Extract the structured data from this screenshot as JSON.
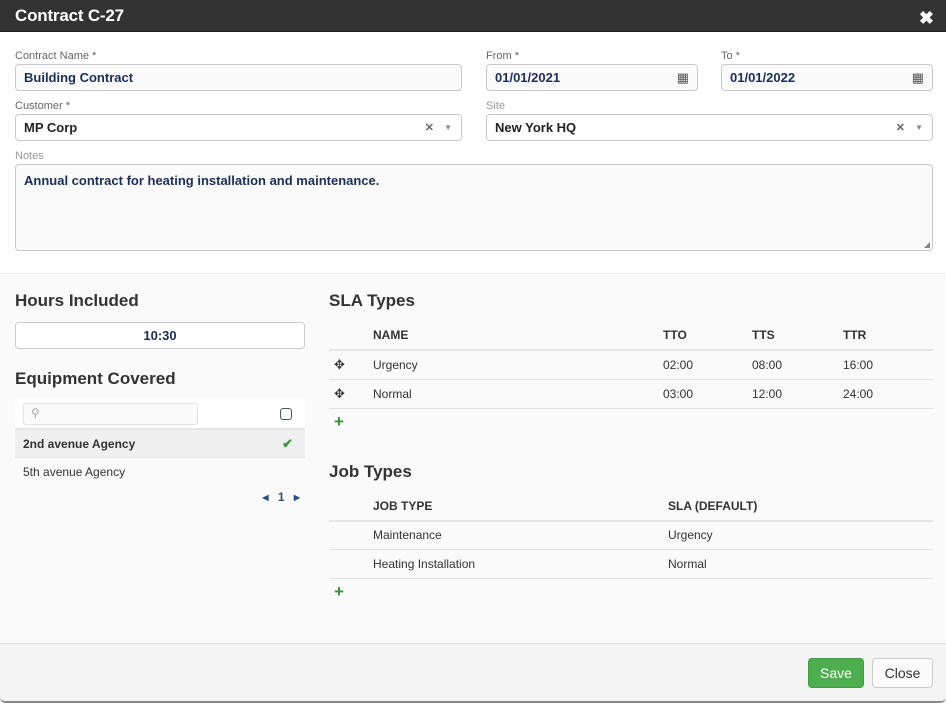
{
  "header": {
    "title": "Contract C-27",
    "close_icon": "close-icon"
  },
  "form": {
    "contract_name": {
      "label": "Contract Name *",
      "value": "Building Contract"
    },
    "from": {
      "label": "From *",
      "value": "01/01/2021",
      "icon": "calendar-icon"
    },
    "to": {
      "label": "To *",
      "value": "01/01/2022",
      "icon": "calendar-icon"
    },
    "customer": {
      "label": "Customer *",
      "value": "MP Corp"
    },
    "site": {
      "label": "Site",
      "value": "New York HQ"
    },
    "notes": {
      "label": "Notes",
      "value": "Annual contract for heating installation and maintenance."
    }
  },
  "hours": {
    "title": "Hours Included",
    "value": "10:30"
  },
  "equipment": {
    "title": "Equipment Covered",
    "search_placeholder": "",
    "items": [
      {
        "name": "2nd avenue Agency",
        "selected": true
      },
      {
        "name": "5th avenue Agency",
        "selected": false
      }
    ],
    "page": "1"
  },
  "sla": {
    "title": "SLA Types",
    "columns": [
      "NAME",
      "TTO",
      "TTS",
      "TTR"
    ],
    "rows": [
      {
        "name": "Urgency",
        "tto": "02:00",
        "tts": "08:00",
        "ttr": "16:00"
      },
      {
        "name": "Normal",
        "tto": "03:00",
        "tts": "12:00",
        "ttr": "24:00"
      }
    ]
  },
  "jobs": {
    "title": "Job Types",
    "columns": [
      "JOB TYPE",
      "SLA (DEFAULT)"
    ],
    "rows": [
      {
        "job_type": "Maintenance",
        "sla": "Urgency"
      },
      {
        "job_type": "Heating Installation",
        "sla": "Normal"
      }
    ]
  },
  "footer": {
    "save_label": "Save",
    "close_label": "Close"
  },
  "colors": {
    "header_bg": "#333333",
    "save_green": "#4cae4c",
    "value_navy": "#1b2e5a",
    "add_green": "#3a8f3a"
  }
}
